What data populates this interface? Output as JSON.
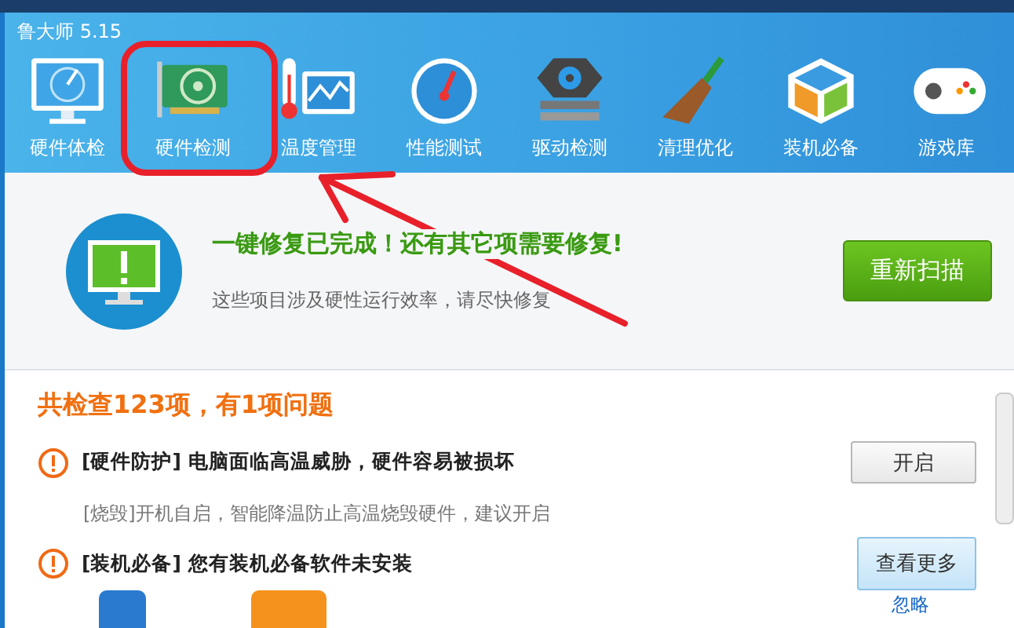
{
  "window": {
    "title": "鲁大师 5.15"
  },
  "nav": [
    {
      "label": "硬件体检"
    },
    {
      "label": "硬件检测"
    },
    {
      "label": "温度管理"
    },
    {
      "label": "性能测试"
    },
    {
      "label": "驱动检测"
    },
    {
      "label": "清理优化"
    },
    {
      "label": "装机必备"
    },
    {
      "label": "游戏库"
    }
  ],
  "banner": {
    "heading": "一键修复已完成！还有其它项需要修复!",
    "subtext": "这些项目涉及硬性运行效率，请尽快修复",
    "button": "重新扫描"
  },
  "summary": "共检查123项，有1项问题",
  "issues": [
    {
      "title": "[硬件防护] 电脑面临高温威胁，硬件容易被损坏",
      "description": "[烧毁]开机自启，智能降温防止高温烧毁硬件，建议开启",
      "button": {
        "label": "开启",
        "kind": "plain"
      }
    },
    {
      "title": "[装机必备] 您有装机必备软件未安装",
      "button": {
        "label": "查看更多",
        "kind": "light"
      },
      "link": "忽略",
      "apps": true
    }
  ]
}
